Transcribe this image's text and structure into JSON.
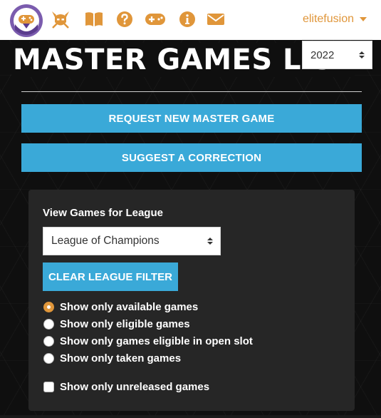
{
  "nav": {
    "icons": [
      "site-logo",
      "helmet-icon",
      "book-icon",
      "question-icon",
      "gamepad-icon",
      "info-icon",
      "envelope-icon"
    ],
    "username": "elitefusion",
    "accent_color": "#e0963a"
  },
  "header": {
    "title": "MASTER GAMES LIST",
    "year_selected": "2022"
  },
  "actions": {
    "request_label": "REQUEST NEW MASTER GAME",
    "suggest_label": "SUGGEST A CORRECTION"
  },
  "filters": {
    "league_label": "View Games for League",
    "league_selected": "League of Champions",
    "clear_label": "CLEAR LEAGUE FILTER",
    "options": [
      {
        "label": "Show only available games",
        "checked": true
      },
      {
        "label": "Show only eligible games",
        "checked": false
      },
      {
        "label": "Show only games eligible in open slot",
        "checked": false
      },
      {
        "label": "Show only taken games",
        "checked": false
      }
    ],
    "unreleased_label": "Show only unreleased games",
    "unreleased_checked": false
  },
  "colors": {
    "button_blue": "#3aa9d8",
    "panel_bg": "#262626",
    "page_bg": "#0f0f0f"
  }
}
